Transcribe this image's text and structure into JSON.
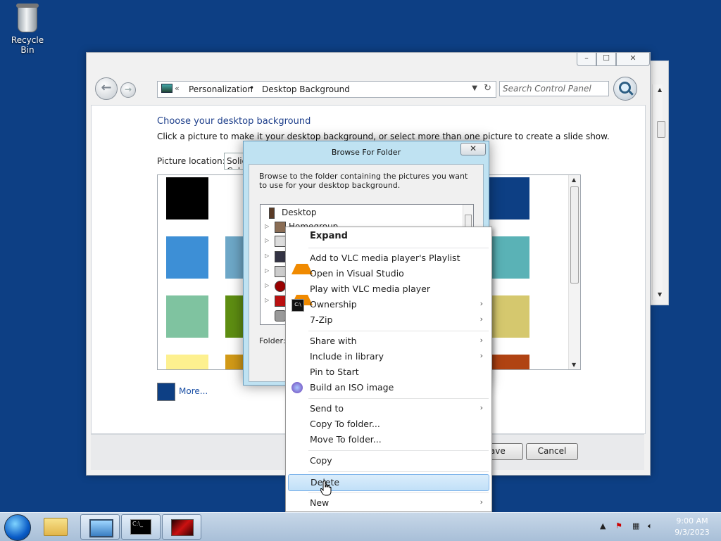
{
  "desktop": {
    "recycle_bin_label": "Recycle Bin"
  },
  "control_panel": {
    "breadcrumb": [
      "Personalization",
      "Desktop Background"
    ],
    "search_placeholder": "Search Control Panel",
    "heading": "Choose your desktop background",
    "description": "Click a picture to make it your desktop background, or select more than one picture to create a slide show.",
    "picture_location_label": "Picture location:",
    "picture_location_value": "Solid Colors",
    "more_link": "More...",
    "save_button": "Save changes",
    "cancel_button": "Cancel",
    "swatch_colors": [
      "#000000",
      "#3d8fd6",
      "#7fc3a0",
      "#fdf08f",
      "#0d3f84"
    ]
  },
  "browse_dialog": {
    "title": "Browse For Folder",
    "description": "Browse to the folder containing the pictures you want to use for your desktop background.",
    "tree_items": [
      "Desktop",
      "Homegroup"
    ],
    "folder_label": "Folder:"
  },
  "context_menu": {
    "items": [
      {
        "label": "Expand",
        "bold": true
      },
      {
        "label": "Add to VLC media player's Playlist",
        "icon": "vlc-icon"
      },
      {
        "label": "Open in Visual Studio"
      },
      {
        "label": "Play with VLC media player",
        "icon": "vlc-icon"
      },
      {
        "label": "Ownership",
        "icon": "cmd-icon",
        "submenu": true
      },
      {
        "label": "7-Zip",
        "submenu": true
      },
      {
        "label": "Share with",
        "submenu": true
      },
      {
        "label": "Include in library",
        "submenu": true
      },
      {
        "label": "Pin to Start"
      },
      {
        "label": "Build an ISO image",
        "icon": "iso-icon"
      },
      {
        "label": "Send to",
        "submenu": true
      },
      {
        "label": "Copy To folder..."
      },
      {
        "label": "Move To folder..."
      },
      {
        "label": "Copy"
      },
      {
        "label": "Delete",
        "highlighted": true
      },
      {
        "label": "New",
        "submenu": true
      }
    ]
  },
  "taskbar": {
    "time": "9:00 AM",
    "date": "9/3/2023"
  }
}
